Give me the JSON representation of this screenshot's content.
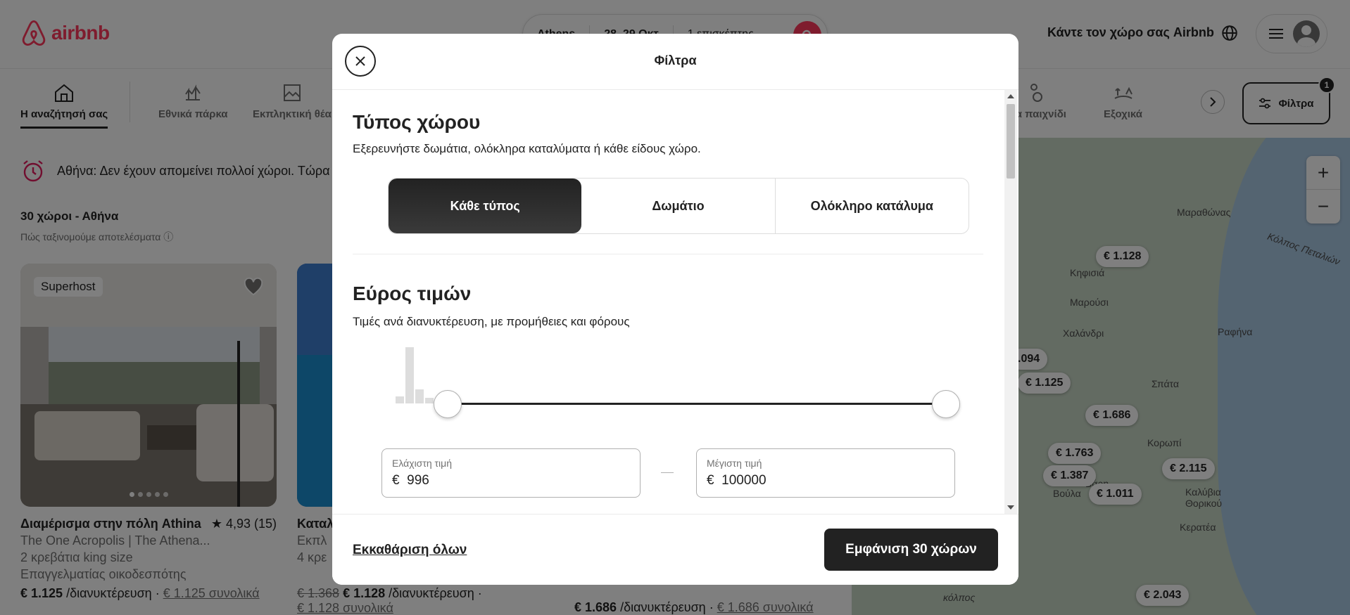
{
  "header": {
    "brand": "airbnb",
    "search": {
      "location": "Athens",
      "dates": "28–29 Οκτ",
      "guests": "1 επισκέπτης"
    },
    "host_link": "Κάντε τον χώρο σας Airbnb"
  },
  "categories": {
    "items": [
      {
        "label": "Η αναζήτησή σας",
        "active": true
      },
      {
        "label": "Εθνικά πάρκα"
      },
      {
        "label": "Εκπληκτική θέα"
      },
      {
        "label": "Για παιχνίδι"
      },
      {
        "label": "Εξοχικά"
      }
    ],
    "filters_label": "Φίλτρα",
    "filters_count": "1"
  },
  "alert": {
    "text": "Αθήνα: Δεν έχουν απομείνει πολλοί χώροι. Τώρα"
  },
  "results": {
    "title": "30 χώροι - Αθήνα",
    "sort_info": "Πώς ταξινομούμε αποτελέσματα"
  },
  "listings": [
    {
      "badge": "Superhost",
      "title": "Διαμέρισμα στην πόλη Athina",
      "rating": "4,93 (15)",
      "line1": "The One Acropolis | The Athena...",
      "line2": "2 κρεβάτια king size",
      "line3": "Επαγγελματίας οικοδεσπότης",
      "price": "€ 1.125",
      "per": " /διανυκτέρευση · ",
      "total": "€ 1.125 συνολικά"
    },
    {
      "title": "Καταλ",
      "line1": "Εκπλ",
      "line2": "4 κρε",
      "old_price": "€ 1.368",
      "price": "€ 1.128",
      "per": " /διανυκτέρευση ·",
      "total": "€ 1.128 συνολικά"
    },
    {
      "price": "€ 1.686",
      "per": " /διανυκτέρευση · ",
      "total": "€ 1.686 συνολικά"
    }
  ],
  "map": {
    "zoom_in": "+",
    "zoom_out": "−",
    "prices": [
      "€ 1.128",
      ".094",
      "€ 1.125",
      "€ 1.686",
      "€ 1.763",
      "€ 1.387",
      "€ 1.011",
      "€ 2.115",
      "€ 2.043"
    ],
    "places": [
      "Μαραθώνας",
      "Κηφισιά",
      "Μαρούσι",
      "Χαλάνδρι",
      "Ραφήνα",
      "Σπάτα",
      "Κορωπί",
      "Βάρη",
      "Καλύβια Θορικού",
      "Κερατέα",
      "Βούλα",
      "Κόλπος Πεταλιών",
      "κόλπος"
    ]
  },
  "modal": {
    "title": "Φίλτρα",
    "type_section": {
      "title": "Τύπος χώρου",
      "subtitle": "Εξερευνήστε δωμάτια, ολόκληρα καταλύματα ή κάθε είδους χώρο.",
      "options": [
        "Κάθε τύπος",
        "Δωμάτιο",
        "Ολόκληρο κατάλυμα"
      ],
      "selected": "Κάθε τύπος"
    },
    "price_section": {
      "title": "Εύρος τιμών",
      "subtitle": "Τιμές ανά διανυκτέρευση, με προμήθειες και φόρους",
      "min_label": "Ελάχιστη τιμή",
      "max_label": "Μέγιστη τιμή",
      "currency": "€",
      "min_value": "996",
      "max_value": "100000",
      "histogram_levels": [
        0.12,
        1.0,
        0.25,
        0.1
      ]
    },
    "footer": {
      "clear_label": "Εκκαθάριση όλων",
      "show_label": "Εμφάνιση 30 χώρων"
    }
  },
  "colors": {
    "brand": "#ff385c",
    "text": "#222222",
    "muted": "#717171"
  }
}
